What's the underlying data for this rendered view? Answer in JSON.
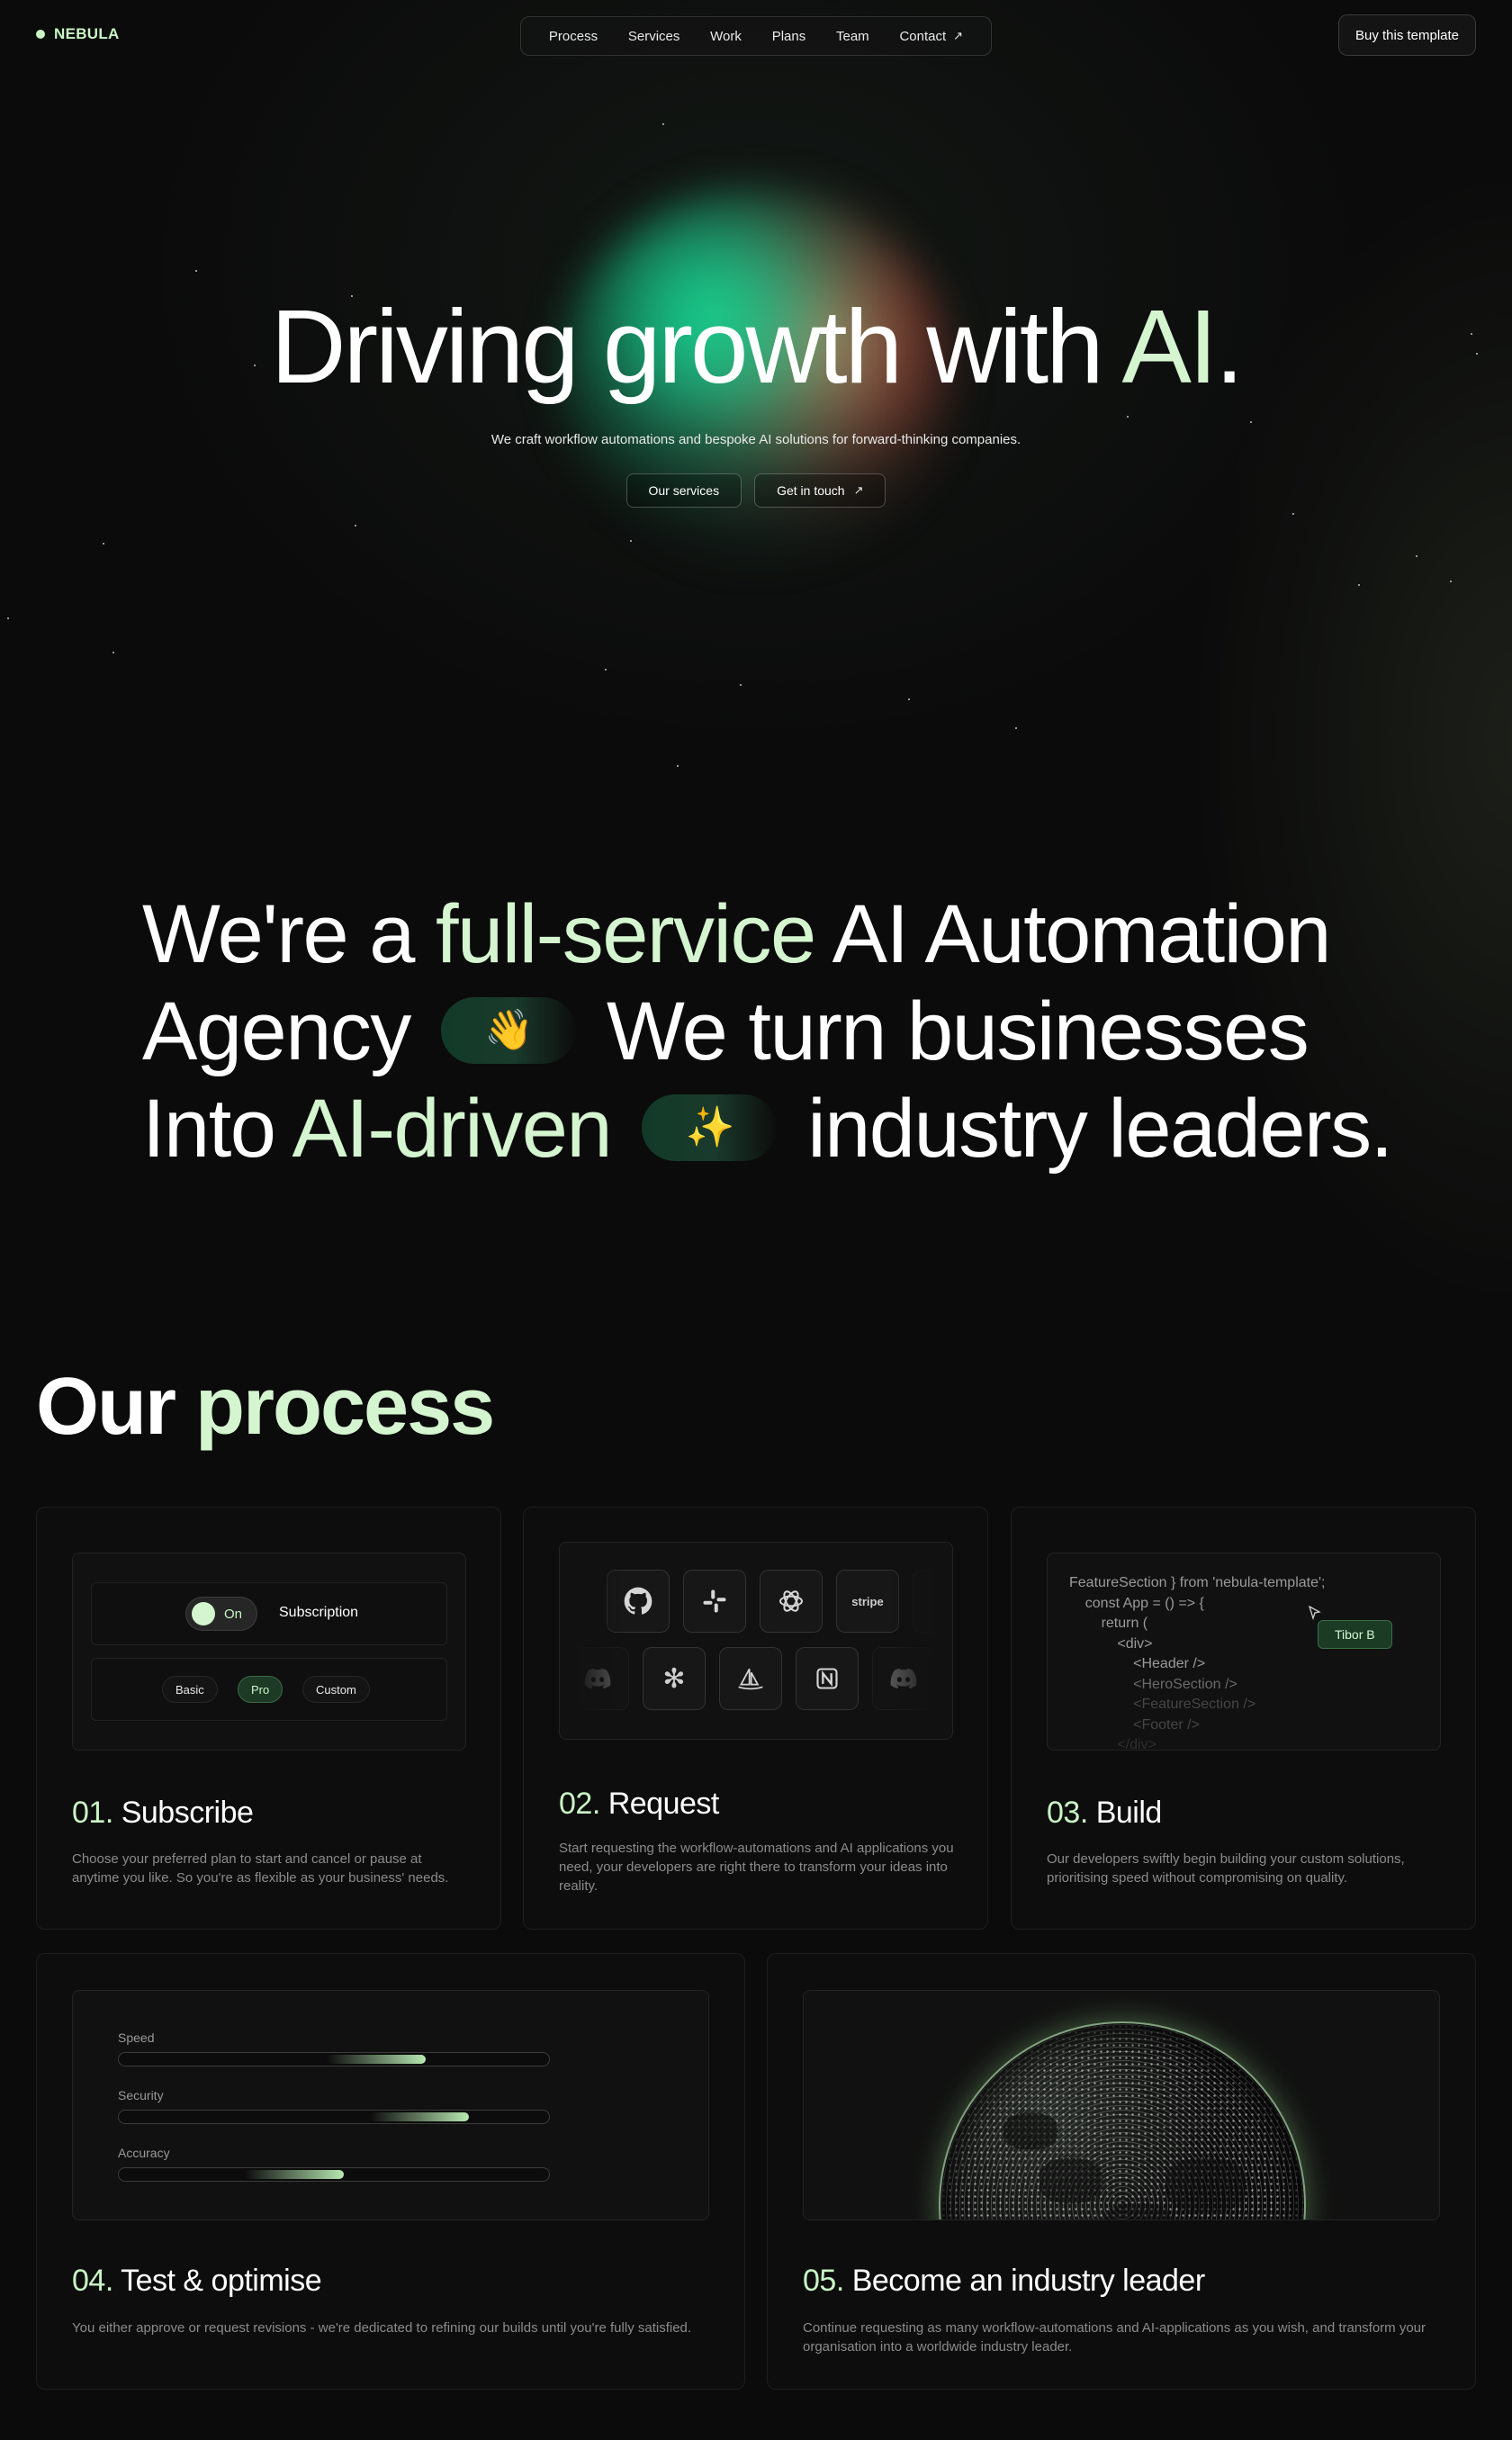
{
  "brand": {
    "name": "NEBULA",
    "accent": "#c9f5c5"
  },
  "nav": {
    "items": [
      {
        "label": "Process"
      },
      {
        "label": "Services"
      },
      {
        "label": "Work"
      },
      {
        "label": "Plans"
      },
      {
        "label": "Team"
      },
      {
        "label": "Contact",
        "icon": "arrow-up-right-icon"
      }
    ],
    "cta": "Buy this template"
  },
  "hero": {
    "title_main": "Driving growth with ",
    "title_highlight": "AI",
    "title_end": ".",
    "subtitle": "We craft workflow automations and bespoke AI solutions for forward-thinking companies.",
    "primary_btn": "Our services",
    "secondary_btn": "Get in touch"
  },
  "statement": {
    "p1": "We're a ",
    "hl1": "full-service",
    "p2": " AI Automation",
    "p3": "Agency",
    "emoji1": "👋",
    "p4": "We turn businesses",
    "p5": "Into ",
    "hl2": "AI-driven",
    "emoji2": "✨",
    "p6": "industry leaders."
  },
  "process": {
    "title_main": "Our ",
    "title_highlight": "process",
    "steps": [
      {
        "num": "01.",
        "title": "Subscribe",
        "desc": "Choose your preferred plan to start and cancel or pause at anytime you like. So you're as flexible as your business' needs.",
        "toggle_label": "On",
        "subscription_label": "Subscription",
        "plans": [
          "Basic",
          "Pro",
          "Custom"
        ],
        "active_plan": "Pro"
      },
      {
        "num": "02.",
        "title": "Request",
        "desc": "Start requesting the workflow-automations and AI applications you need, your developers are right there to transform your ideas into reality.",
        "logos_row1": [
          "github-icon",
          "slack-icon",
          "openai-icon",
          "stripe"
        ],
        "logos_row2": [
          "discord-icon",
          "asterisk-icon",
          "midjourney-icon",
          "notion-icon",
          "discord-icon"
        ],
        "stripe_label": "stripe"
      },
      {
        "num": "03.",
        "title": "Build",
        "desc": "Our developers swiftly begin building your custom solutions, prioritising speed without compromising on quality.",
        "code": [
          "FeatureSection } from 'nebula-template';",
          "    const App = () => {",
          "        return (",
          "            <div>",
          "                <Header />",
          "                <HeroSection />",
          "                <FeatureSection />",
          "                <Footer />",
          "            </div>"
        ],
        "cursor_name": "Tibor B"
      },
      {
        "num": "04.",
        "title": "Test & optimise",
        "desc": "You either approve or request revisions - we're dedicated to refining our builds until you're fully satisfied.",
        "bars": [
          {
            "label": "Speed",
            "value": 0.71
          },
          {
            "label": "Security",
            "value": 0.81
          },
          {
            "label": "Accuracy",
            "value": 0.52
          }
        ]
      },
      {
        "num": "05.",
        "title": "Become an industry leader",
        "desc": "Continue requesting as many workflow-automations and AI-applications as you wish, and transform your organisation into a worldwide industry leader."
      }
    ]
  }
}
